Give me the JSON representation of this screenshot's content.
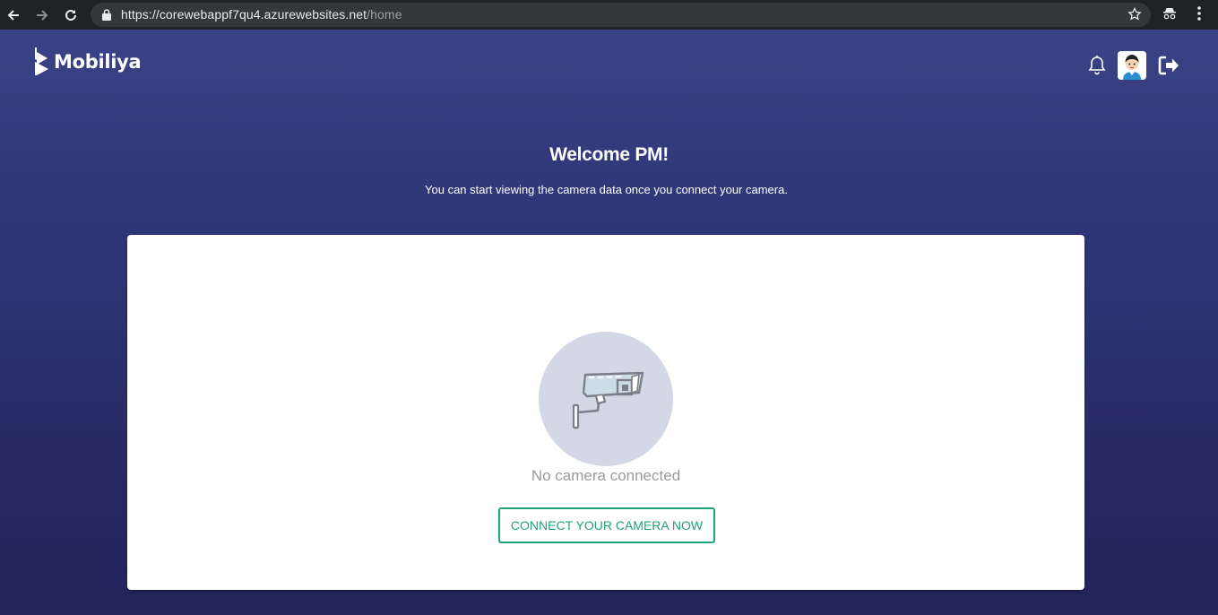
{
  "browser": {
    "url_host": "https://corewebappf7qu4.azurewebsites.net",
    "url_path": "/home"
  },
  "header": {
    "logo_text": "Mobiliya"
  },
  "welcome": {
    "title": "Welcome PM!",
    "subtitle": "You can start viewing the camera data once you connect your camera."
  },
  "card": {
    "status_text": "No camera connected",
    "connect_button": "CONNECT YOUR CAMERA NOW"
  },
  "colors": {
    "accent": "#1fa37b",
    "page_bg": "#2e3577",
    "circle_bg": "#d3d7e6"
  }
}
